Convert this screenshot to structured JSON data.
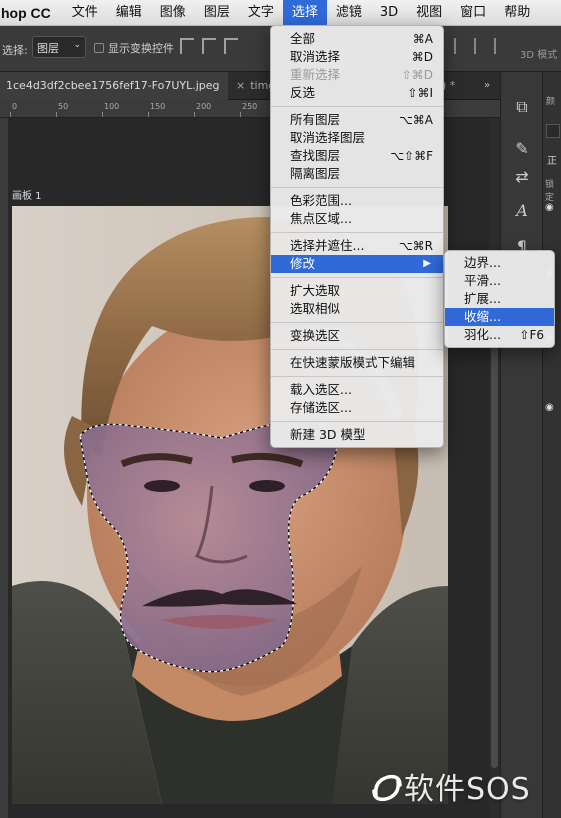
{
  "menubar": {
    "app_name": "hop CC",
    "items": [
      "文件",
      "编辑",
      "图像",
      "图层",
      "文字",
      "选择",
      "滤镜",
      "3D",
      "视图",
      "窗口",
      "帮助"
    ],
    "active_index": 5
  },
  "options_bar": {
    "auto_select_label": "选择:",
    "auto_select_value": "图层",
    "show_transform_label": "显示变换控件",
    "mode_3d_label": "3D 模式"
  },
  "tabs": [
    {
      "label": "1ce4d3df2cbee1756fef17-Fo7UYL.jpeg",
      "active": true
    },
    {
      "label": "timg",
      "active": false
    },
    {
      "label": ") *",
      "active": false
    }
  ],
  "ruler": {
    "labels": [
      "0",
      "50",
      "100",
      "150",
      "200",
      "250"
    ]
  },
  "artboard": {
    "label": "画板 1"
  },
  "select_menu": {
    "groups": [
      [
        {
          "label": "全部",
          "shortcut": "⌘A",
          "disabled": false
        },
        {
          "label": "取消选择",
          "shortcut": "⌘D",
          "disabled": false
        },
        {
          "label": "重新选择",
          "shortcut": "⇧⌘D",
          "disabled": true
        },
        {
          "label": "反选",
          "shortcut": "⇧⌘I",
          "disabled": false
        }
      ],
      [
        {
          "label": "所有图层",
          "shortcut": "⌥⌘A",
          "disabled": false
        },
        {
          "label": "取消选择图层",
          "shortcut": "",
          "disabled": false
        },
        {
          "label": "查找图层",
          "shortcut": "⌥⇧⌘F",
          "disabled": false
        },
        {
          "label": "隔离图层",
          "shortcut": "",
          "disabled": false
        }
      ],
      [
        {
          "label": "色彩范围...",
          "shortcut": "",
          "disabled": false
        },
        {
          "label": "焦点区域...",
          "shortcut": "",
          "disabled": false
        }
      ],
      [
        {
          "label": "选择并遮住...",
          "shortcut": "⌥⌘R",
          "disabled": false
        },
        {
          "label": "修改",
          "shortcut": "",
          "disabled": false,
          "submenu": true,
          "highlighted": true
        }
      ],
      [
        {
          "label": "扩大选取",
          "shortcut": "",
          "disabled": false
        },
        {
          "label": "选取相似",
          "shortcut": "",
          "disabled": false
        }
      ],
      [
        {
          "label": "变换选区",
          "shortcut": "",
          "disabled": false
        }
      ],
      [
        {
          "label": "在快速蒙版模式下编辑",
          "shortcut": "",
          "disabled": false
        }
      ],
      [
        {
          "label": "载入选区...",
          "shortcut": "",
          "disabled": false
        },
        {
          "label": "存储选区...",
          "shortcut": "",
          "disabled": false
        }
      ],
      [
        {
          "label": "新建 3D 模型",
          "shortcut": "",
          "disabled": false
        }
      ]
    ]
  },
  "modify_submenu": {
    "items": [
      {
        "label": "边界...",
        "shortcut": "",
        "highlighted": false
      },
      {
        "label": "平滑...",
        "shortcut": "",
        "highlighted": false
      },
      {
        "label": "扩展...",
        "shortcut": "",
        "highlighted": false
      },
      {
        "label": "收缩...",
        "shortcut": "",
        "highlighted": true
      },
      {
        "label": "羽化...",
        "shortcut": "⇧F6",
        "highlighted": false
      }
    ]
  },
  "right_panel": {
    "partial_labels": [
      "颜",
      "锁定",
      "正"
    ]
  },
  "watermark": {
    "text": "软件SOS"
  },
  "colors": {
    "menu_highlight": "#2f6ad8",
    "menubar_bg": "#e6e6e6",
    "workspace_bg": "#282828"
  }
}
